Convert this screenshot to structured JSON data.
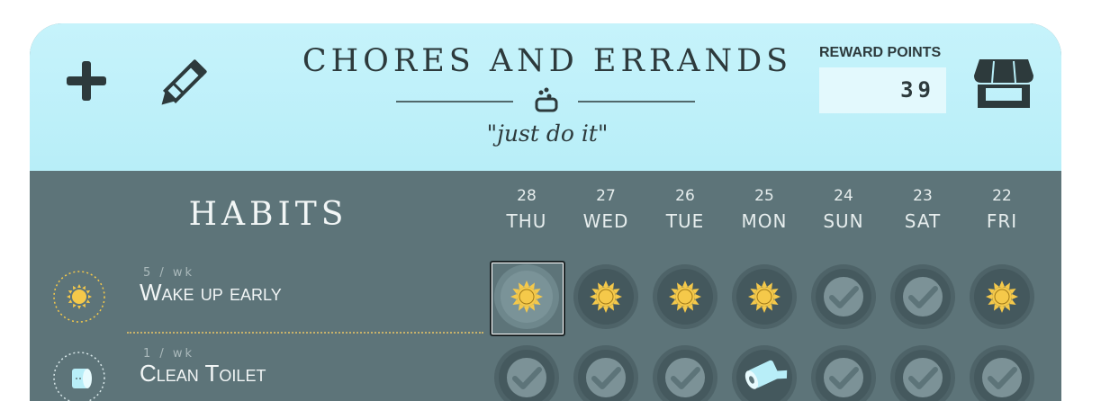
{
  "header": {
    "title": "CHORES AND ERRANDS",
    "subtitle": "\"just do it\"",
    "reward_points_label": "REWARD POINTS",
    "reward_points_value": "39"
  },
  "habits_title": "HABITS",
  "days": [
    {
      "num": "28",
      "name": "THU"
    },
    {
      "num": "27",
      "name": "WED"
    },
    {
      "num": "26",
      "name": "TUE"
    },
    {
      "num": "25",
      "name": "MON"
    },
    {
      "num": "24",
      "name": "SUN"
    },
    {
      "num": "23",
      "name": "SAT"
    },
    {
      "num": "22",
      "name": "FRI"
    }
  ],
  "habits": [
    {
      "freq": "5 / wk",
      "name": "Wake up early",
      "icon": "sun-icon",
      "status": [
        "sun",
        "sun",
        "sun",
        "sun",
        "check",
        "check",
        "sun"
      ]
    },
    {
      "freq": "1 / wk",
      "name": "Clean Toilet",
      "icon": "toilet-paper-icon",
      "status": [
        "check",
        "check",
        "check",
        "toilet-paper",
        "check",
        "check",
        "check"
      ]
    }
  ],
  "colors": {
    "header_bg": "#c6f3fb",
    "body_bg": "#5d7479",
    "sun": "#f5c94a",
    "toilet_paper": "#b8eef8"
  }
}
